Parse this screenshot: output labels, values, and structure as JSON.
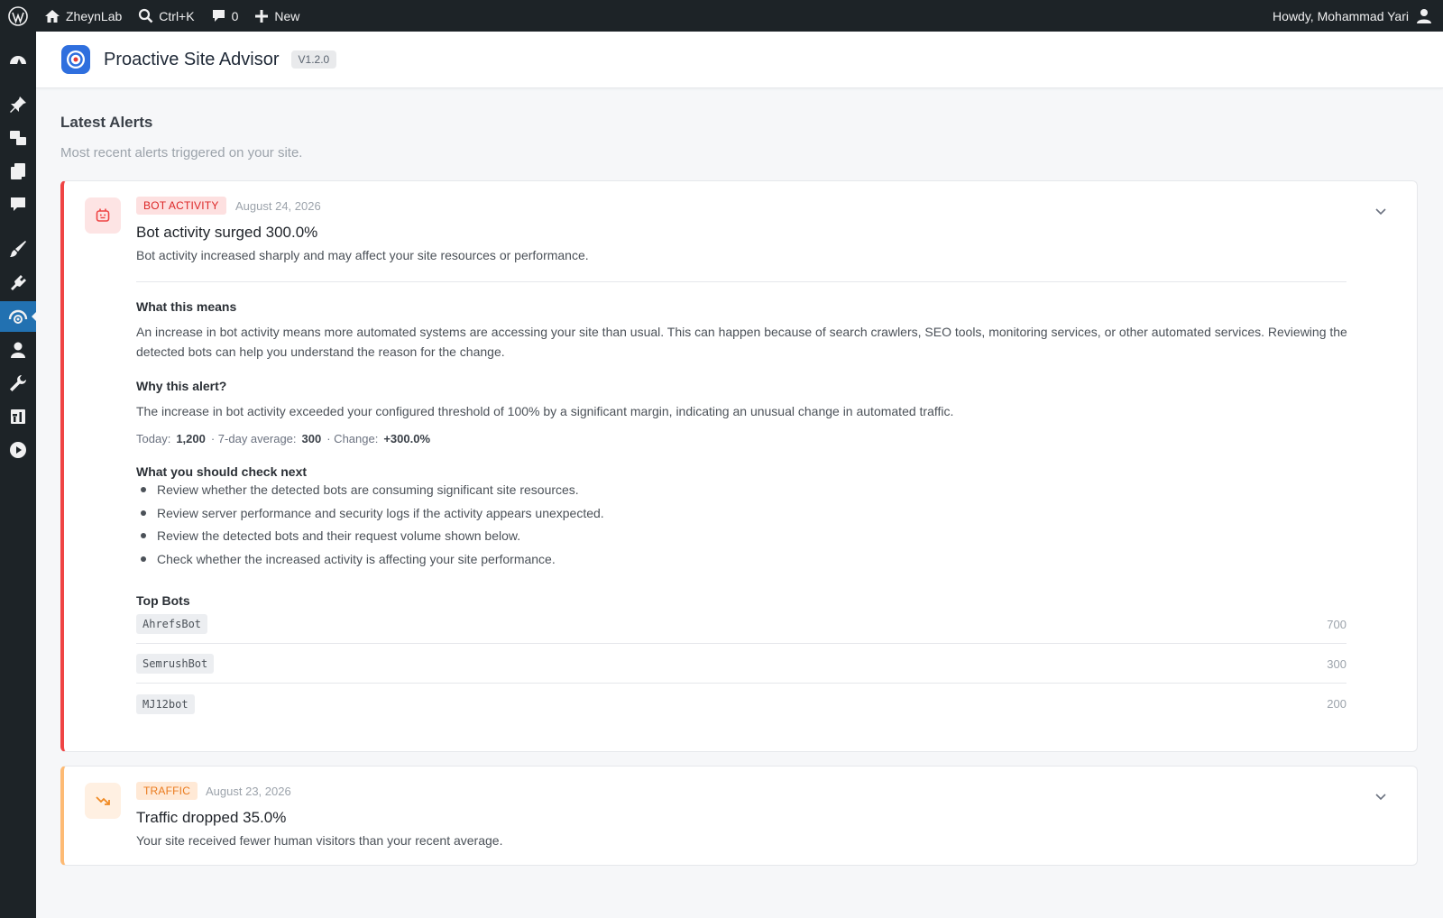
{
  "adminbar": {
    "site_name": "ZheynLab",
    "search_shortcut": "Ctrl+K",
    "comments_count": "0",
    "new_label": "New",
    "greeting": "Howdy, Mohammad Yari"
  },
  "sidemenu": {
    "items": [
      "dashboard",
      "posts",
      "media",
      "pages",
      "comments",
      "appearance",
      "plugins",
      "site-advisor",
      "users",
      "tools",
      "settings",
      "video"
    ],
    "active": "site-advisor"
  },
  "plugin": {
    "title": "Proactive Site Advisor",
    "version": "V1.2.0"
  },
  "section": {
    "title": "Latest Alerts",
    "subtitle": "Most recent alerts triggered on your site."
  },
  "alerts": [
    {
      "badge": "BOT ACTIVITY",
      "date": "August 24, 2026",
      "title": "Bot activity surged 300.0%",
      "description": "Bot activity increased sharply and may affect your site resources or performance.",
      "what_means_heading": "What this means",
      "what_means_text": "An increase in bot activity means more automated systems are accessing your site than usual. This can happen because of search crawlers, SEO tools, monitoring services, or other automated services. Reviewing the detected bots can help you understand the reason for the change.",
      "why_heading": "Why this alert?",
      "why_text": "The increase in bot activity exceeded your configured threshold of 100% by a significant margin, indicating an unusual change in automated traffic.",
      "stats": {
        "today_label": "Today:",
        "today_value": "1,200",
        "avg_label": "· 7-day average:",
        "avg_value": "300",
        "change_label": "· Change:",
        "change_value": "+300.0%"
      },
      "next_heading": "What you should check next",
      "next_items": [
        "Review whether the detected bots are consuming significant site resources.",
        "Review server performance and security logs if the activity appears unexpected.",
        "Review the detected bots and their request volume shown below.",
        "Check whether the increased activity is affecting your site performance."
      ],
      "bots_heading": "Top Bots",
      "bots": [
        {
          "name": "AhrefsBot",
          "count": "700"
        },
        {
          "name": "SemrushBot",
          "count": "300"
        },
        {
          "name": "MJ12bot",
          "count": "200"
        }
      ],
      "accent": "#ef4444"
    },
    {
      "badge": "TRAFFIC",
      "date": "August 23, 2026",
      "title": "Traffic dropped 35.0%",
      "description": "Your site received fewer human visitors than your recent average.",
      "accent": "#fdba74"
    }
  ]
}
